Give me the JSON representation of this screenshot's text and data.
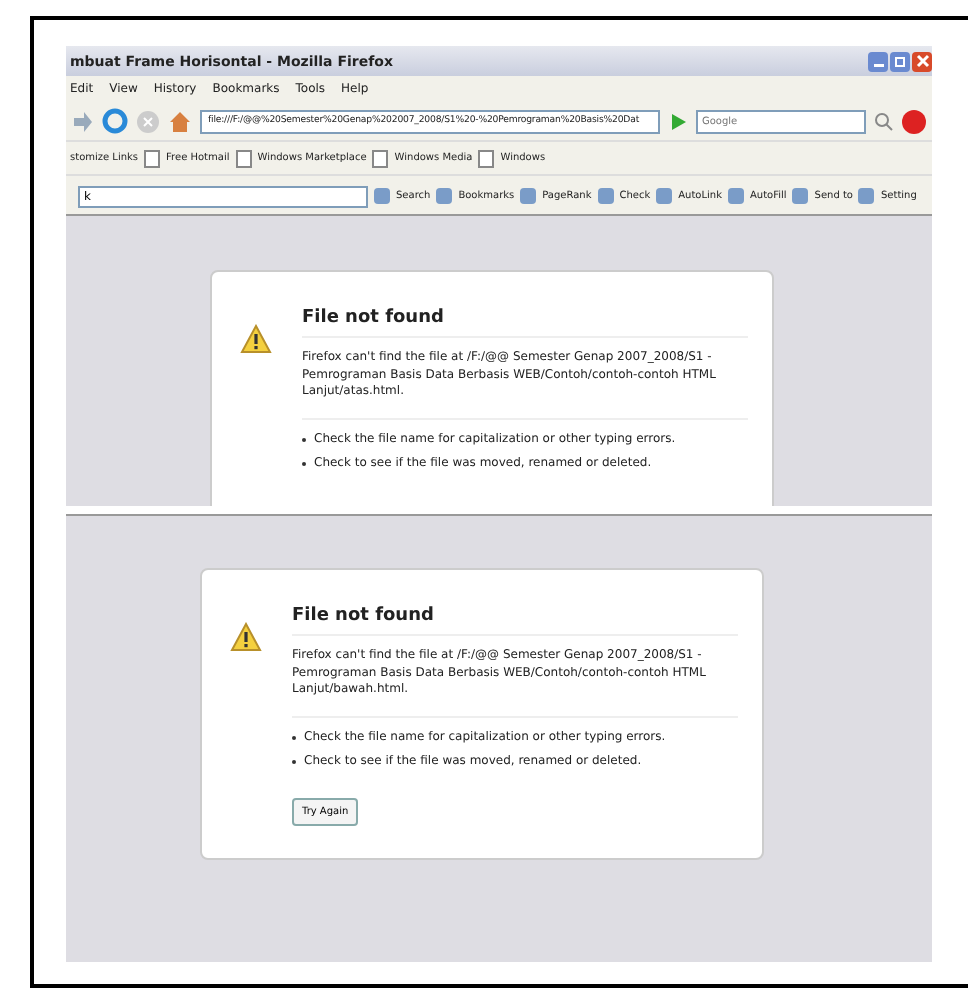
{
  "window": {
    "title": "mbuat Frame Horisontal - Mozilla Firefox"
  },
  "menu": [
    "Edit",
    "View",
    "History",
    "Bookmarks",
    "Tools",
    "Help"
  ],
  "navigation": {
    "address": "file:///F:/@@%20Semester%20Genap%202007_2008/S1%20-%20Pemrograman%20Basis%20Dat",
    "search_placeholder": "Google"
  },
  "bookmarks": [
    "stomize Links",
    "Free Hotmail",
    "Windows Marketplace",
    "Windows Media",
    "Windows"
  ],
  "toolbar": {
    "field_value": "k",
    "items": [
      "Search",
      "Bookmarks",
      "PageRank",
      "Check",
      "AutoLink",
      "AutoFill",
      "Send to",
      "Setting"
    ]
  },
  "frames": [
    {
      "title": "File not found",
      "message": "Firefox can't find the file at /F:/@@ Semester Genap 2007_2008/S1 - Pemrograman Basis Data Berbasis WEB/Contoh/contoh-contoh HTML Lanjut/atas.html.",
      "tips": [
        "Check the file name for capitalization or other typing errors.",
        "Check to see if the file was moved, renamed or deleted."
      ]
    },
    {
      "title": "File not found",
      "message": "Firefox can't find the file at /F:/@@ Semester Genap 2007_2008/S1 - Pemrograman Basis Data Berbasis WEB/Contoh/contoh-contoh HTML Lanjut/bawah.html.",
      "tips": [
        "Check the file name for capitalization or other typing errors.",
        "Check to see if the file was moved, renamed or deleted."
      ],
      "button": "Try Again"
    }
  ]
}
